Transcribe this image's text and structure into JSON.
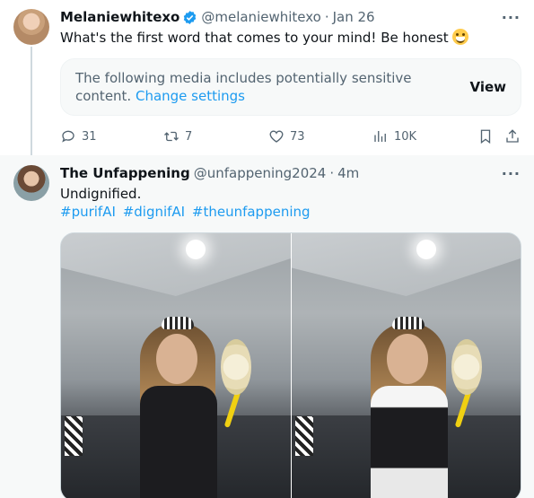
{
  "tweet1": {
    "display_name": "Melaniewhitexo",
    "handle": "@melaniewhitexo",
    "separator": "·",
    "time": "Jan 26",
    "text": "What's the first word that comes to your mind! Be honest",
    "emoji": "grinning-face-icon",
    "verified_color": "#1d9bf0",
    "sensitive_notice": {
      "text": "The following media includes potentially sensitive content.",
      "link": "Change settings",
      "button": "View"
    },
    "actions": {
      "replies": "31",
      "retweets": "7",
      "likes": "73",
      "views": "10K"
    }
  },
  "tweet2": {
    "display_name": "The Unfappening",
    "handle": "@unfappening2024",
    "separator": "·",
    "time": "4m",
    "text": "Undignified.",
    "hashtags": [
      "#purifAI",
      "#dignifAI",
      "#theunfappening"
    ]
  },
  "colors": {
    "accent": "#1d9bf0",
    "muted": "#536471",
    "text": "#0f1419"
  }
}
